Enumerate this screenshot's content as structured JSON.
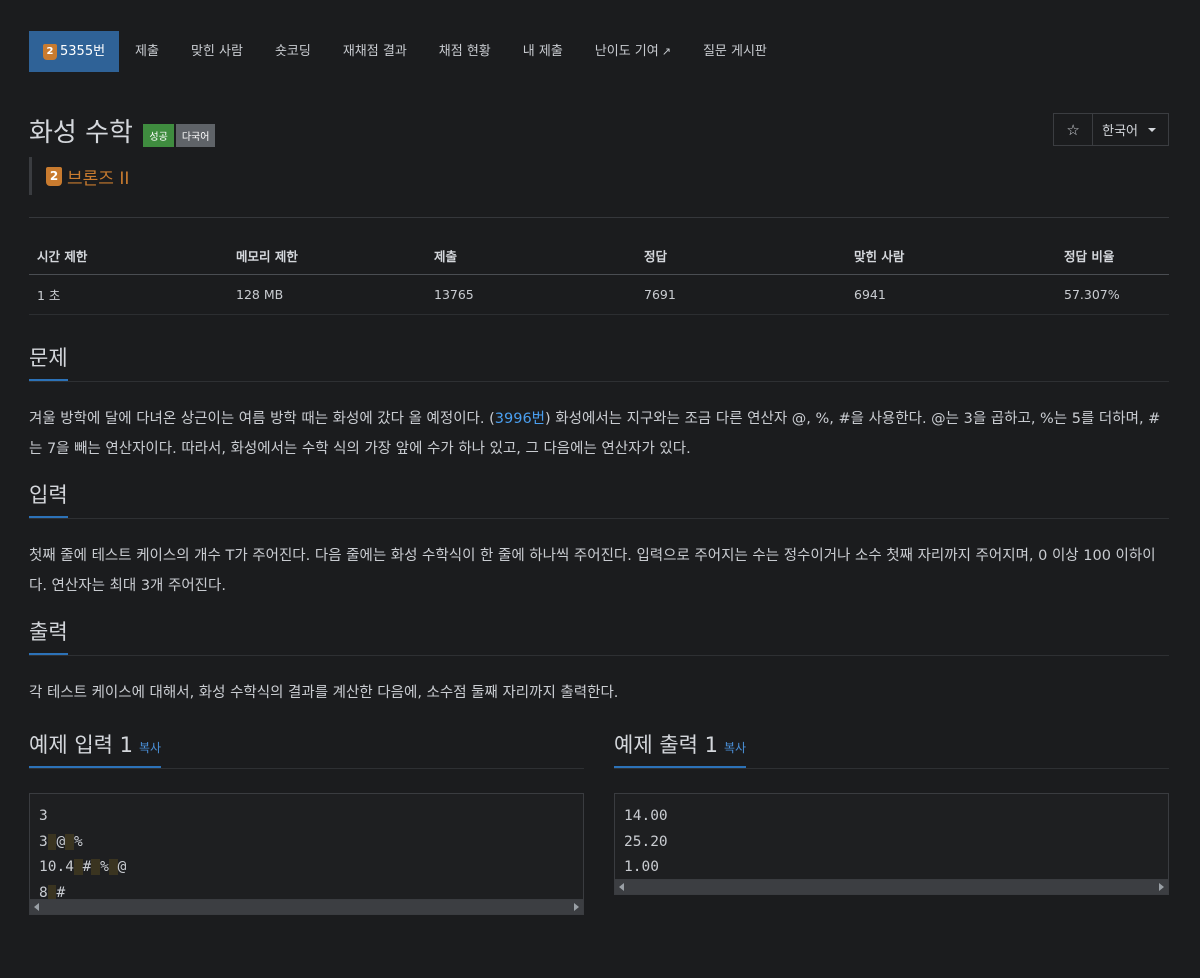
{
  "nav": {
    "active_badge": "2",
    "problem_tab": "5355번",
    "tabs": [
      "제출",
      "맞힌 사람",
      "숏코딩",
      "재채점 결과",
      "채점 현황",
      "내 제출",
      "난이도 기여",
      "질문 게시판"
    ]
  },
  "problem": {
    "title": "화성 수학",
    "label_success": "성공",
    "label_multilang": "다국어",
    "language": "한국어",
    "tier_badge": "2",
    "tier_name": "브론즈 II"
  },
  "stats": {
    "headers": [
      "시간 제한",
      "메모리 제한",
      "제출",
      "정답",
      "맞힌 사람",
      "정답 비율"
    ],
    "values": [
      "1 초",
      "128 MB",
      "13765",
      "7691",
      "6941",
      "57.307%"
    ]
  },
  "sections": {
    "problem_head": "문제",
    "problem_text_1": "겨울 방학에 달에 다녀온 상근이는 여름 방학 때는 화성에 갔다 올 예정이다. (",
    "problem_link": "3996번",
    "problem_text_2": ") 화성에서는 지구와는 조금 다른 연산자 @, %, #을 사용한다. @는 3을 곱하고, %는 5를 더하며, #는 7을 빼는 연산자이다. 따라서, 화성에서는 수학 식의 가장 앞에 수가 하나 있고, 그 다음에는 연산자가 있다.",
    "input_head": "입력",
    "input_text": "첫째 줄에 테스트 케이스의 개수 T가 주어진다. 다음 줄에는 화성 수학식이 한 줄에 하나씩 주어진다. 입력으로 주어지는 수는 정수이거나 소수 첫째 자리까지 주어지며, 0 이상 100 이하이다. 연산자는 최대 3개 주어진다.",
    "output_head": "출력",
    "output_text": "각 테스트 케이스에 대해서, 화성 수학식의 결과를 계산한 다음에, 소수점 둘째 자리까지 출력한다."
  },
  "examples": {
    "input_head": "예제 입력 1",
    "output_head": "예제 출력 1",
    "copy_label": "복사",
    "input_lines": [
      "3",
      "3 @ %",
      "10.4 # % @",
      "8 #"
    ],
    "output_lines": [
      "14.00",
      "25.20",
      "1.00"
    ]
  }
}
